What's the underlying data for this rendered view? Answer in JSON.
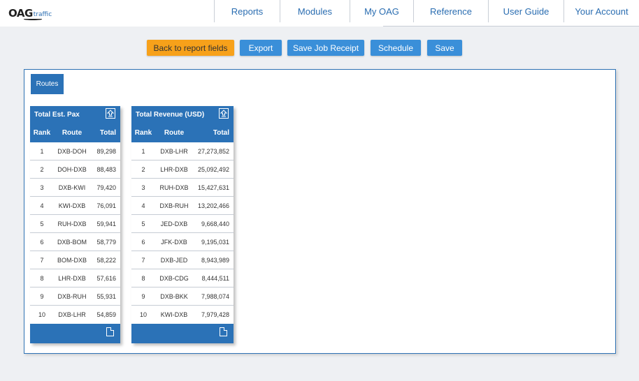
{
  "logo": {
    "main": "OAG",
    "sub": "traffic"
  },
  "nav": [
    {
      "label": "Reports"
    },
    {
      "label": "Modules"
    },
    {
      "label": "My OAG"
    },
    {
      "label": "Reference"
    },
    {
      "label": "User Guide"
    },
    {
      "label": "Your Account"
    }
  ],
  "actions": {
    "back": "Back to report fields",
    "export": "Export",
    "save_job_receipt": "Save Job Receipt",
    "schedule": "Schedule",
    "save": "Save"
  },
  "tab": {
    "label": "Routes"
  },
  "colors": {
    "brand_blue": "#2b72b7",
    "button_blue": "#3a8fd9",
    "button_orange": "#f7a11a"
  },
  "tables": [
    {
      "title": "Total Est. Pax",
      "columns": {
        "rank": "Rank",
        "route": "Route",
        "total": "Total"
      },
      "rows": [
        {
          "rank": "1",
          "route": "DXB-DOH",
          "total": "89,298"
        },
        {
          "rank": "2",
          "route": "DOH-DXB",
          "total": "88,483"
        },
        {
          "rank": "3",
          "route": "DXB-KWI",
          "total": "79,420"
        },
        {
          "rank": "4",
          "route": "KWI-DXB",
          "total": "76,091"
        },
        {
          "rank": "5",
          "route": "RUH-DXB",
          "total": "59,941"
        },
        {
          "rank": "6",
          "route": "DXB-BOM",
          "total": "58,779"
        },
        {
          "rank": "7",
          "route": "BOM-DXB",
          "total": "58,222"
        },
        {
          "rank": "8",
          "route": "LHR-DXB",
          "total": "57,616"
        },
        {
          "rank": "9",
          "route": "DXB-RUH",
          "total": "55,931"
        },
        {
          "rank": "10",
          "route": "DXB-LHR",
          "total": "54,859"
        }
      ]
    },
    {
      "title": "Total Revenue (USD)",
      "columns": {
        "rank": "Rank",
        "route": "Route",
        "total": "Total"
      },
      "rows": [
        {
          "rank": "1",
          "route": "DXB-LHR",
          "total": "27,273,852"
        },
        {
          "rank": "2",
          "route": "LHR-DXB",
          "total": "25,092,492"
        },
        {
          "rank": "3",
          "route": "RUH-DXB",
          "total": "15,427,631"
        },
        {
          "rank": "4",
          "route": "DXB-RUH",
          "total": "13,202,466"
        },
        {
          "rank": "5",
          "route": "JED-DXB",
          "total": "9,668,440"
        },
        {
          "rank": "6",
          "route": "JFK-DXB",
          "total": "9,195,031"
        },
        {
          "rank": "7",
          "route": "DXB-JED",
          "total": "8,943,989"
        },
        {
          "rank": "8",
          "route": "DXB-CDG",
          "total": "8,444,511"
        },
        {
          "rank": "9",
          "route": "DXB-BKK",
          "total": "7,988,074"
        },
        {
          "rank": "10",
          "route": "KWI-DXB",
          "total": "7,979,428"
        }
      ]
    }
  ]
}
